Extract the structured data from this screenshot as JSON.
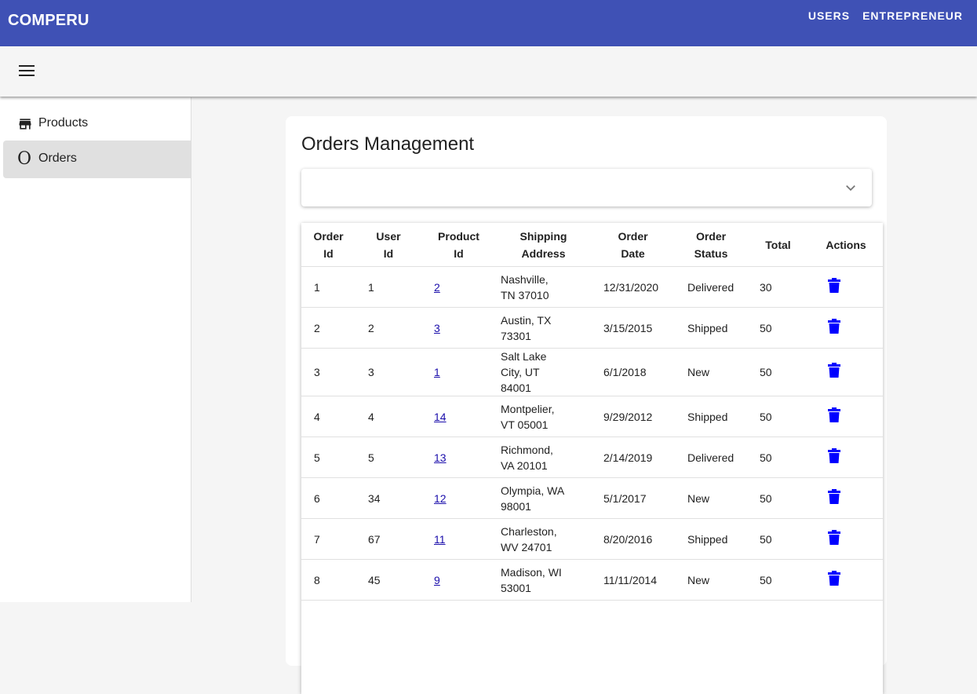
{
  "app": {
    "title": "COMPERU"
  },
  "topnav": [
    "USERS",
    "ENTREPRENEUR"
  ],
  "sidebar": {
    "items": [
      {
        "label": "Products",
        "icon": "store-icon"
      },
      {
        "label": "Orders",
        "icon": "O"
      }
    ]
  },
  "page": {
    "title": "Orders Management"
  },
  "table": {
    "headers": [
      [
        "Order",
        "Id"
      ],
      [
        "User",
        "Id"
      ],
      [
        "Product",
        "Id"
      ],
      [
        "Shipping",
        "Address"
      ],
      [
        "Order",
        "Date"
      ],
      [
        "Order",
        "Status"
      ],
      [
        "Total"
      ],
      [
        "Actions"
      ]
    ],
    "rows": [
      {
        "order_id": "1",
        "user_id": "1",
        "product_id": "2",
        "address": [
          "Nashville,",
          "TN 37010"
        ],
        "date": "12/31/2020",
        "status": "Delivered",
        "total": "30"
      },
      {
        "order_id": "2",
        "user_id": "2",
        "product_id": "3",
        "address": [
          "Austin, TX",
          "73301"
        ],
        "date": "3/15/2015",
        "status": "Shipped",
        "total": "50"
      },
      {
        "order_id": "3",
        "user_id": "3",
        "product_id": "1",
        "address": [
          "Salt Lake",
          "City, UT",
          "84001"
        ],
        "date": "6/1/2018",
        "status": "New",
        "total": "50"
      },
      {
        "order_id": "4",
        "user_id": "4",
        "product_id": "14",
        "address": [
          "Montpelier,",
          "VT 05001"
        ],
        "date": "9/29/2012",
        "status": "Shipped",
        "total": "50"
      },
      {
        "order_id": "5",
        "user_id": "5",
        "product_id": "13",
        "address": [
          "Richmond,",
          "VA 20101"
        ],
        "date": "2/14/2019",
        "status": "Delivered",
        "total": "50"
      },
      {
        "order_id": "6",
        "user_id": "34",
        "product_id": "12",
        "address": [
          "Olympia, WA",
          "98001"
        ],
        "date": "5/1/2017",
        "status": "New",
        "total": "50"
      },
      {
        "order_id": "7",
        "user_id": "67",
        "product_id": "11",
        "address": [
          "Charleston,",
          "WV 24701"
        ],
        "date": "8/20/2016",
        "status": "Shipped",
        "total": "50"
      },
      {
        "order_id": "8",
        "user_id": "45",
        "product_id": "9",
        "address": [
          "Madison, WI",
          "53001"
        ],
        "date": "11/11/2014",
        "status": "New",
        "total": "50"
      }
    ]
  },
  "colors": {
    "appbar": "#3f51b5",
    "trash": "#0000ff",
    "link": "#1a0dab"
  },
  "icons": {
    "menu": "menu-icon",
    "store": "store-icon",
    "expand": "chevron-down-icon",
    "delete": "trash-icon"
  }
}
